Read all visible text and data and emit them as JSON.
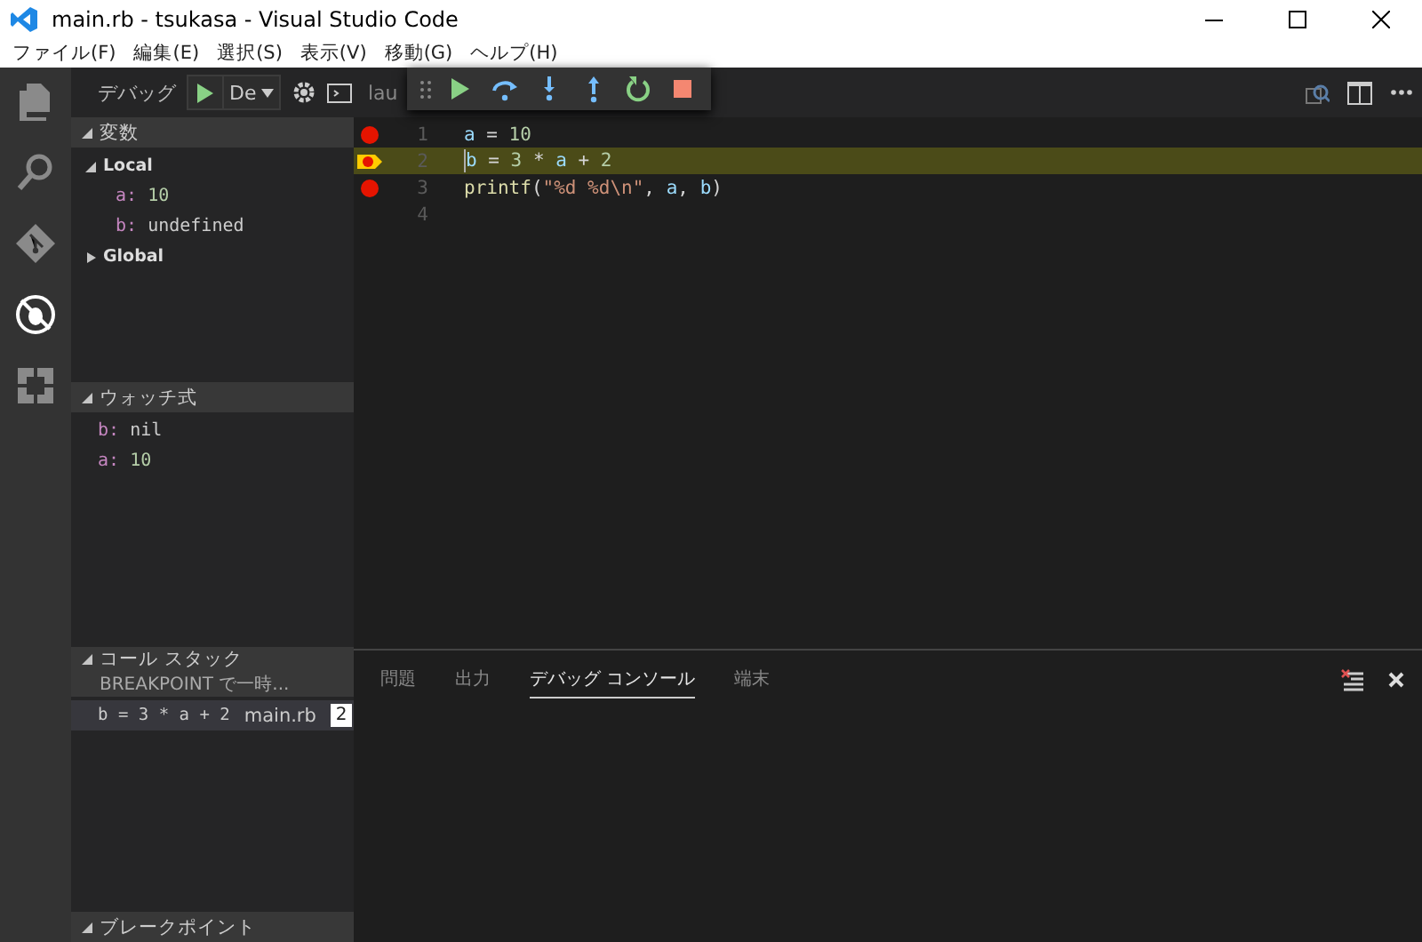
{
  "window": {
    "title": "main.rb - tsukasa - Visual Studio Code"
  },
  "menu": [
    "ファイル(F)",
    "編集(E)",
    "選択(S)",
    "表示(V)",
    "移動(G)",
    "ヘルプ(H)"
  ],
  "activity_bar": [
    {
      "kind": "files",
      "selected": false
    },
    {
      "kind": "search",
      "selected": false
    },
    {
      "kind": "git",
      "selected": false
    },
    {
      "kind": "debug",
      "selected": true
    },
    {
      "kind": "extensions",
      "selected": false
    }
  ],
  "sidebar": {
    "title": "デバッグ",
    "configuration": "De",
    "sections": [
      {
        "kind": "variables",
        "title": "変数",
        "expanded": true,
        "scopes": [
          {
            "name": "Local",
            "expanded": true,
            "children": [
              {
                "name": "a:",
                "value": "10",
                "kind": "number"
              },
              {
                "name": "b:",
                "value": "undefined",
                "kind": "other"
              }
            ]
          },
          {
            "name": "Global",
            "expanded": false
          }
        ]
      },
      {
        "kind": "watch",
        "title": "ウォッチ式",
        "expanded": true,
        "items": [
          {
            "name": "b:",
            "value": "nil",
            "kind": "other"
          },
          {
            "name": "a:",
            "value": "10",
            "kind": "number"
          }
        ]
      },
      {
        "kind": "callstack",
        "title": "コール スタック",
        "expanded": true,
        "status": "BREAKPOINT で一時...",
        "frames": [
          {
            "name": "b = 3 * a + 2",
            "file": "main.rb",
            "line": "2",
            "selected": true
          }
        ]
      },
      {
        "kind": "breakpoints",
        "title": "ブレークポイント",
        "expanded": true
      }
    ]
  },
  "editor": {
    "tab": "lau",
    "debug_toolbar": [
      {
        "kind": "continue"
      },
      {
        "kind": "step-over"
      },
      {
        "kind": "step-into"
      },
      {
        "kind": "step-out"
      },
      {
        "kind": "restart"
      },
      {
        "kind": "stop"
      }
    ],
    "actions": [
      {
        "kind": "open-changes"
      },
      {
        "kind": "split"
      },
      {
        "kind": "more"
      }
    ],
    "lines": [
      {
        "number": "1",
        "breakpoint": true,
        "current": false,
        "tokens": [
          {
            "text": "a",
            "kind": "variable"
          },
          {
            "text": " = ",
            "kind": "operator"
          },
          {
            "text": "10",
            "kind": "number"
          }
        ]
      },
      {
        "number": "2",
        "breakpoint": true,
        "current": true,
        "tokens": [
          {
            "text": "b",
            "kind": "variable"
          },
          {
            "text": " = ",
            "kind": "operator"
          },
          {
            "text": "3",
            "kind": "number"
          },
          {
            "text": " * ",
            "kind": "operator"
          },
          {
            "text": "a",
            "kind": "variable"
          },
          {
            "text": " + ",
            "kind": "operator"
          },
          {
            "text": "2",
            "kind": "number"
          }
        ]
      },
      {
        "number": "3",
        "breakpoint": true,
        "current": false,
        "tokens": [
          {
            "text": "printf",
            "kind": "function"
          },
          {
            "text": "(",
            "kind": "punctuation"
          },
          {
            "text": "\"%d %d\\n\"",
            "kind": "string"
          },
          {
            "text": ", ",
            "kind": "punctuation"
          },
          {
            "text": "a",
            "kind": "variable"
          },
          {
            "text": ", ",
            "kind": "punctuation"
          },
          {
            "text": "b",
            "kind": "variable"
          },
          {
            "text": ")",
            "kind": "punctuation"
          }
        ]
      },
      {
        "number": "4",
        "breakpoint": false,
        "current": false
      }
    ]
  },
  "panel": {
    "tabs": [
      {
        "label": "問題",
        "selected": false
      },
      {
        "label": "出力",
        "selected": false
      },
      {
        "label": "デバッグ コンソール",
        "selected": true
      },
      {
        "label": "端末",
        "selected": false
      }
    ],
    "actions": [
      {
        "kind": "clear"
      },
      {
        "kind": "close"
      }
    ]
  }
}
